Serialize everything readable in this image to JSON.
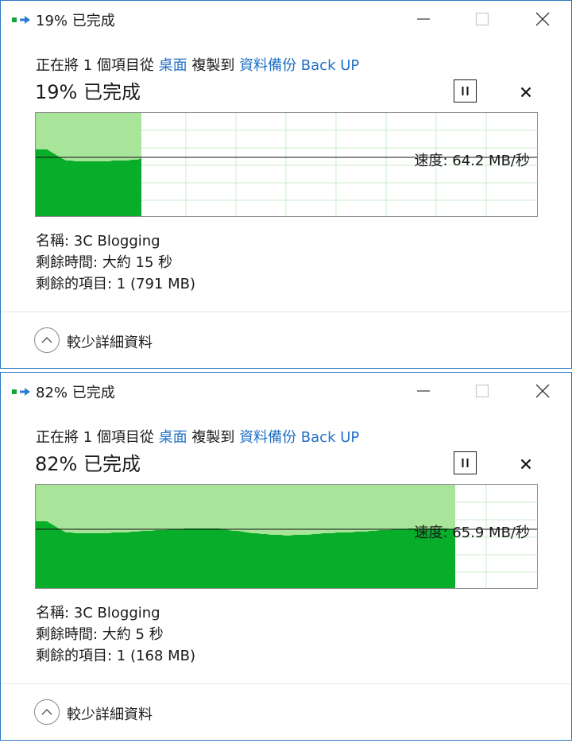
{
  "dialogs": [
    {
      "title": "19% 已完成",
      "description": {
        "prefix": "正在將 1 個項目從 ",
        "source": "桌面",
        "middle": " 複製到 ",
        "destination": "資料備份 Back UP"
      },
      "heading": "19% 已完成",
      "progress_fraction": 0.21,
      "speed_level_fraction": 0.57,
      "speed_text": "速度: 64.2 MB/秒",
      "details": [
        {
          "key": "名稱: ",
          "value": "3C Blogging"
        },
        {
          "key": "剩餘時間: ",
          "value": "大約 15 秒"
        },
        {
          "key": "剩餘的項目: ",
          "value": "1 (791 MB)"
        }
      ],
      "details_toggle_label": "較少詳細資料"
    },
    {
      "title": "82% 已完成",
      "description": {
        "prefix": "正在將 1 個項目從 ",
        "source": "桌面",
        "middle": " 複製到 ",
        "destination": "資料備份 Back UP"
      },
      "heading": "82% 已完成",
      "progress_fraction": 0.836,
      "speed_level_fraction": 0.57,
      "speed_text": "速度: 65.9 MB/秒",
      "details": [
        {
          "key": "名稱: ",
          "value": "3C Blogging"
        },
        {
          "key": "剩餘時間: ",
          "value": "大約 5 秒"
        },
        {
          "key": "剩餘的項目: ",
          "value": "1 (168 MB)"
        }
      ],
      "details_toggle_label": "較少詳細資料"
    }
  ],
  "colors": {
    "accent_border": "#2b78c6",
    "link": "#1f6fc5",
    "progress_light": "#a8e49a",
    "progress_dark": "#08ad2a",
    "grid_line": "#cdeccd"
  },
  "icons": {
    "title": "copy-progress-icon",
    "minimize": "minimize-icon",
    "maximize": "maximize-icon",
    "close": "close-icon",
    "pause": "pause-icon",
    "cancel": "cancel-icon",
    "details_toggle": "chevron-up-icon"
  }
}
